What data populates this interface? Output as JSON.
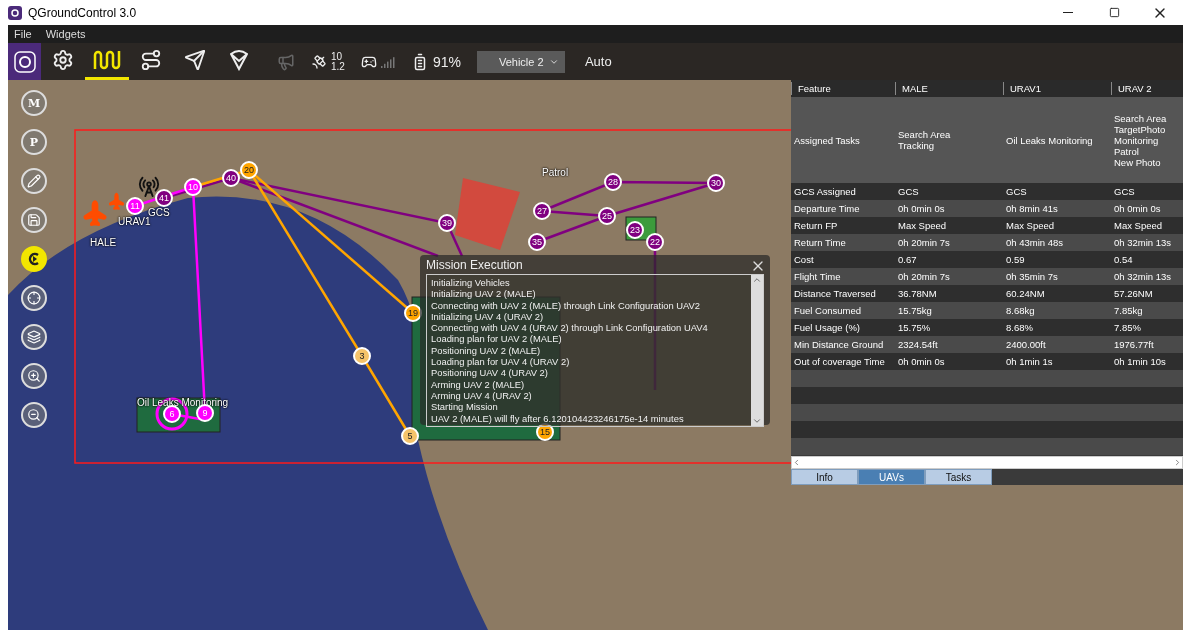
{
  "window": {
    "title": "QGroundControl 3.0"
  },
  "menu": [
    "File",
    "Widgets"
  ],
  "toolbar": {
    "tools": [
      {
        "kind": "settings",
        "selected": false
      },
      {
        "kind": "analyze",
        "selected": true
      },
      {
        "kind": "plan",
        "selected": false
      },
      {
        "kind": "fly",
        "selected": false
      },
      {
        "kind": "parachute",
        "selected": false
      }
    ],
    "satellites": "10",
    "hdop": "1.2",
    "battery": "91%",
    "vehicle": "Vehicle 2",
    "mode": "Auto"
  },
  "map_tools": [
    {
      "kind": "letter",
      "label": "M",
      "selected": false
    },
    {
      "kind": "letter",
      "label": "P",
      "selected": false
    },
    {
      "kind": "edit",
      "selected": false
    },
    {
      "kind": "save",
      "selected": false
    },
    {
      "kind": "center",
      "selected": true
    },
    {
      "kind": "locate",
      "selected": false
    },
    {
      "kind": "layers",
      "selected": false
    },
    {
      "kind": "zoom_in",
      "selected": false
    },
    {
      "kind": "zoom_out",
      "selected": false
    }
  ],
  "map": {
    "labels": [
      "HALE",
      "URAV1",
      "GCS",
      "Patrol",
      "Oil Leaks Monitoring"
    ],
    "markers": [
      {
        "label": "11",
        "color": "#ff00ff"
      },
      {
        "label": "41",
        "color": "#800080"
      },
      {
        "label": "10",
        "color": "#ff00ff"
      },
      {
        "label": "40",
        "color": "#800080"
      },
      {
        "label": "20",
        "color": "#ffa500"
      },
      {
        "label": "39",
        "color": "#800080"
      },
      {
        "label": "3",
        "color": "#f5c36a"
      },
      {
        "label": "19",
        "color": "#ffa500"
      },
      {
        "label": "5",
        "color": "#f5c36a"
      },
      {
        "label": "6",
        "color": "#ff00ff"
      },
      {
        "label": "9",
        "color": "#ff00ff"
      },
      {
        "label": "28",
        "color": "#800080"
      },
      {
        "label": "30",
        "color": "#800080"
      },
      {
        "label": "27",
        "color": "#800080"
      },
      {
        "label": "25",
        "color": "#800080"
      },
      {
        "label": "23",
        "color": "#800080"
      },
      {
        "label": "22",
        "color": "#800080"
      },
      {
        "label": "35",
        "color": "#800080"
      },
      {
        "label": "15",
        "color": "#ffa500"
      }
    ]
  },
  "uav_table": {
    "columns": [
      "Feature",
      "MALE",
      "URAV1",
      "URAV 2"
    ],
    "rows": [
      {
        "feature": "Assigned Tasks",
        "values": [
          "Search Area\nTracking",
          "Oil Leaks Monitoring",
          "Search Area\nTargetPhoto\nMonitoring\nPatrol\nNew Photo"
        ]
      },
      {
        "feature": "GCS Assigned",
        "values": [
          "GCS",
          "GCS",
          "GCS"
        ]
      },
      {
        "feature": "Departure Time",
        "values": [
          "0h 0min 0s",
          "0h 8min 41s",
          "0h 0min 0s"
        ]
      },
      {
        "feature": "Return FP",
        "values": [
          "Max Speed",
          "Max Speed",
          "Max Speed"
        ]
      },
      {
        "feature": "Return Time",
        "values": [
          "0h 20min 7s",
          "0h 43min 48s",
          "0h 32min 13s"
        ]
      },
      {
        "feature": "Cost",
        "values": [
          "0.67",
          "0.59",
          "0.54"
        ]
      },
      {
        "feature": "Flight Time",
        "values": [
          "0h 20min 7s",
          "0h 35min 7s",
          "0h 32min 13s"
        ]
      },
      {
        "feature": "Distance Traversed",
        "values": [
          "36.78NM",
          "60.24NM",
          "57.26NM"
        ]
      },
      {
        "feature": "Fuel Consumed",
        "values": [
          "15.75kg",
          "8.68kg",
          "7.85kg"
        ]
      },
      {
        "feature": "Fuel Usage (%)",
        "values": [
          "15.75%",
          "8.68%",
          "7.85%"
        ]
      },
      {
        "feature": "Min Distance Ground",
        "values": [
          "2324.54ft",
          "2400.00ft",
          "1976.77ft"
        ]
      },
      {
        "feature": "Out of coverage Time",
        "values": [
          "0h 0min 0s",
          "0h 1min 1s",
          "0h 1min 10s"
        ]
      }
    ]
  },
  "panel_tabs": [
    {
      "label": "Info",
      "selected": false
    },
    {
      "label": "UAVs",
      "selected": true
    },
    {
      "label": "Tasks",
      "selected": false
    }
  ],
  "mission_dialog": {
    "title": "Mission Execution",
    "log": [
      "Initializing Vehicles",
      "Initializing UAV 2 (MALE)",
      "Connecting with UAV 2 (MALE) through Link Configuration UAV2",
      "Initializing UAV 4 (URAV 2)",
      "Connecting with UAV 4 (URAV 2) through Link Configuration UAV4",
      "Loading plan for UAV 2 (MALE)",
      "Positioning UAV 2 (MALE)",
      "Loading plan for UAV 4 (URAV 2)",
      "Positioning UAV 4 (URAV 2)",
      "Arming UAV 2 (MALE)",
      "Arming UAV 4 (URAV 2)",
      "Starting Mission",
      "UAV 2 (MALE) will fly after 6.120104423246175e-14 minutes"
    ]
  }
}
